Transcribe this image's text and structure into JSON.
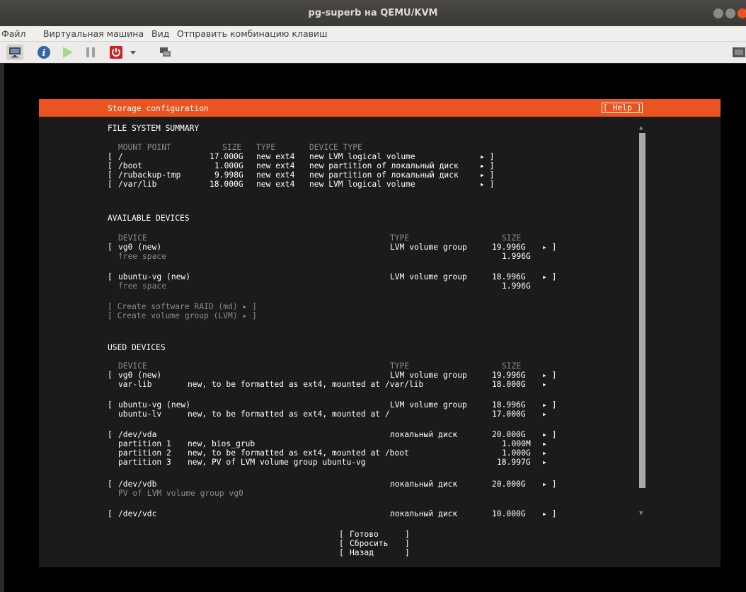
{
  "window": {
    "title": "pg-superb на QEMU/KVM"
  },
  "menu": [
    "Файл",
    "Виртуальная машина",
    "Вид",
    "Отправить комбинацию клавиш"
  ],
  "toolbar_icons": [
    "monitor-icon",
    "info-icon",
    "play-icon",
    "pause-icon",
    "power-icon",
    "dropdown-icon",
    "screens-icon",
    "fullscreen-icon"
  ],
  "colors": {
    "accent": "#e95420",
    "panel": "#1b1b1b"
  },
  "header": {
    "title": "Storage configuration",
    "help": "[ Help ]"
  },
  "fs": {
    "title": "FILE SYSTEM SUMMARY",
    "cols": {
      "mount": "MOUNT POINT",
      "size": "SIZE",
      "type": "TYPE",
      "devtype": "DEVICE TYPE"
    },
    "rows": [
      {
        "mount": "/",
        "size": "17.000G",
        "type": "new ext4",
        "devtype": "new LVM logical volume"
      },
      {
        "mount": "/boot",
        "size": "1.000G",
        "type": "new ext4",
        "devtype": "new partition of локальный диск"
      },
      {
        "mount": "/rubackup-tmp",
        "size": "9.998G",
        "type": "new ext4",
        "devtype": "new partition of локальный диск"
      },
      {
        "mount": "/var/lib",
        "size": "18.000G",
        "type": "new ext4",
        "devtype": "new LVM logical volume"
      }
    ]
  },
  "avail": {
    "title": "AVAILABLE DEVICES",
    "cols": {
      "device": "DEVICE",
      "type": "TYPE",
      "size": "SIZE"
    },
    "items": [
      {
        "name": "vg0 (new)",
        "type": "LVM volume group",
        "size": "19.996G",
        "free": "free space",
        "free_size": "1.996G"
      },
      {
        "name": "ubuntu-vg (new)",
        "type": "LVM volume group",
        "size": "18.996G",
        "free": "free space",
        "free_size": "1.996G"
      }
    ],
    "actions": [
      "[ Create software RAID (md) ▸ ]",
      "[ Create volume group (LVM) ▸ ]"
    ]
  },
  "used": {
    "title": "USED DEVICES",
    "cols": {
      "device": "DEVICE",
      "type": "TYPE",
      "size": "SIZE"
    },
    "d1": {
      "name": "vg0 (new)",
      "type": "LVM volume group",
      "size": "19.996G",
      "sub_name": "var-lib",
      "sub_desc": "new, to be formatted as ext4, mounted at /var/lib",
      "sub_size": "18.000G"
    },
    "d2": {
      "name": "ubuntu-vg (new)",
      "type": "LVM volume group",
      "size": "18.996G",
      "sub_name": "ubuntu-lv",
      "sub_desc": "new, to be formatted as ext4, mounted at /",
      "sub_size": "17.000G"
    },
    "vda": {
      "name": "/dev/vda",
      "type": "локальный диск",
      "size": "20.000G",
      "parts": [
        {
          "name": "partition 1",
          "desc": "new, bios_grub",
          "size": "1.000M"
        },
        {
          "name": "partition 2",
          "desc": "new, to be formatted as ext4, mounted at /boot",
          "size": "1.000G"
        },
        {
          "name": "partition 3",
          "desc": "new, PV of LVM volume group ubuntu-vg",
          "size": "18.997G"
        }
      ]
    },
    "vdb": {
      "name": "/dev/vdb",
      "type": "локальный диск",
      "size": "20.000G",
      "note": "PV of LVM volume group vg0"
    },
    "vdc": {
      "name": "/dev/vdc",
      "type": "локальный диск",
      "size": "10.000G"
    }
  },
  "buttons": {
    "done": "Готово",
    "reset": "Сбросить",
    "back": "Назад"
  }
}
